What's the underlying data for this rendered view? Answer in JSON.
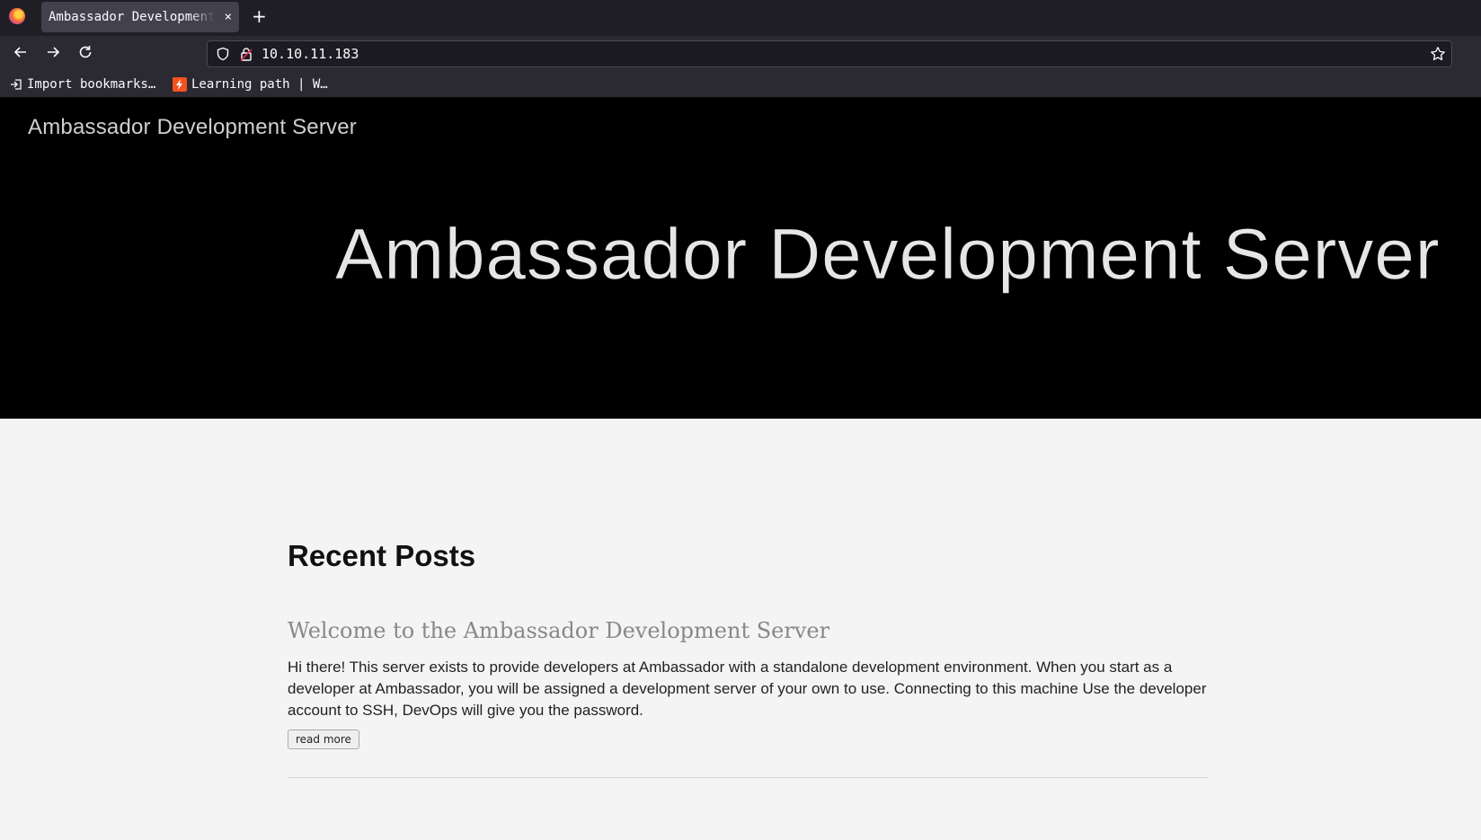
{
  "browser": {
    "tab_title": "Ambassador Development Server",
    "tab_close": "×",
    "new_tab": "+",
    "url": "10.10.11.183",
    "bookmarks": [
      {
        "label": "Import bookmarks…",
        "icon": "import-icon"
      },
      {
        "label": "Learning path | W…",
        "icon": "lightning-favicon"
      }
    ]
  },
  "site": {
    "brand": "Ambassador Development Server",
    "hero_title": "Ambassador Development Server"
  },
  "main": {
    "section_heading": "Recent Posts",
    "posts": [
      {
        "title": "Welcome to the Ambassador Development Server",
        "body": "Hi there! This server exists to provide developers at Ambassador with a standalone development environment. When you start as a developer at Ambassador, you will be assigned a development server of your own to use. Connecting to this machine Use the developer account to SSH, DevOps will give you the password.",
        "button": "read more"
      }
    ]
  },
  "colors": {
    "hero_bg": "#000000",
    "page_bg": "#f4f4f4",
    "favicon_accent": "#f4511e"
  }
}
